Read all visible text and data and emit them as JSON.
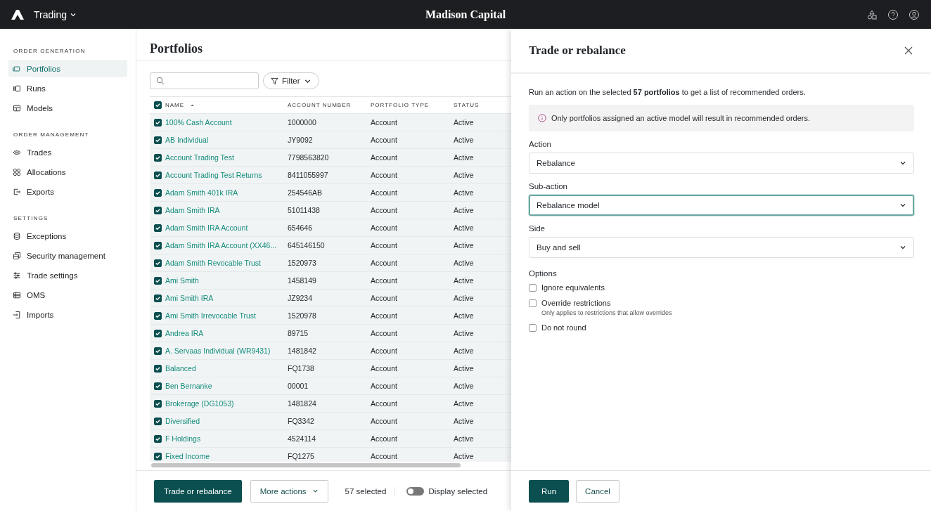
{
  "topbar": {
    "app_name": "Trading",
    "title": "Madison Capital"
  },
  "sidebar": {
    "sections": [
      {
        "heading": "ORDER GENERATION",
        "items": [
          {
            "label": "Portfolios",
            "selected": true
          },
          {
            "label": "Runs",
            "selected": false
          },
          {
            "label": "Models",
            "selected": false
          }
        ]
      },
      {
        "heading": "ORDER MANAGEMENT",
        "items": [
          {
            "label": "Trades",
            "selected": false
          },
          {
            "label": "Allocations",
            "selected": false
          },
          {
            "label": "Exports",
            "selected": false
          }
        ]
      },
      {
        "heading": "SETTINGS",
        "items": [
          {
            "label": "Exceptions",
            "selected": false
          },
          {
            "label": "Security management",
            "selected": false
          },
          {
            "label": "Trade settings",
            "selected": false
          },
          {
            "label": "OMS",
            "selected": false
          },
          {
            "label": "Imports",
            "selected": false
          }
        ]
      }
    ]
  },
  "portfolios": {
    "title": "Portfolios",
    "filter": "Filter",
    "table": {
      "all_checked": true,
      "columns": [
        "NAME",
        "ACCOUNT NUMBER",
        "PORTFOLIO TYPE",
        "STATUS"
      ],
      "rows": [
        {
          "name": "100% Cash Account",
          "account_number": "1000000",
          "portfolio_type": "Account",
          "status": "Active",
          "checked": true
        },
        {
          "name": "AB Individual",
          "account_number": "JY9092",
          "portfolio_type": "Account",
          "status": "Active",
          "checked": true
        },
        {
          "name": "Account Trading Test",
          "account_number": "7798563820",
          "portfolio_type": "Account",
          "status": "Active",
          "checked": true
        },
        {
          "name": "Account Trading Test Returns",
          "account_number": "8411055997",
          "portfolio_type": "Account",
          "status": "Active",
          "checked": true
        },
        {
          "name": "Adam Smith 401k IRA",
          "account_number": "254546AB",
          "portfolio_type": "Account",
          "status": "Active",
          "checked": true
        },
        {
          "name": "Adam Smith IRA",
          "account_number": "51011438",
          "portfolio_type": "Account",
          "status": "Active",
          "checked": true
        },
        {
          "name": "Adam Smith IRA Account",
          "account_number": "654646",
          "portfolio_type": "Account",
          "status": "Active",
          "checked": true
        },
        {
          "name": "Adam Smith IRA Account (XX46...",
          "account_number": "645146150",
          "portfolio_type": "Account",
          "status": "Active",
          "checked": true
        },
        {
          "name": "Adam Smith Revocable Trust",
          "account_number": "1520973",
          "portfolio_type": "Account",
          "status": "Active",
          "checked": true
        },
        {
          "name": "Ami Smith",
          "account_number": "1458149",
          "portfolio_type": "Account",
          "status": "Active",
          "checked": true
        },
        {
          "name": "Ami Smith IRA",
          "account_number": "JZ9234",
          "portfolio_type": "Account",
          "status": "Active",
          "checked": true
        },
        {
          "name": "Ami Smith Irrevocable Trust",
          "account_number": "1520978",
          "portfolio_type": "Account",
          "status": "Active",
          "checked": true
        },
        {
          "name": "Andrea IRA",
          "account_number": "89715",
          "portfolio_type": "Account",
          "status": "Active",
          "checked": true
        },
        {
          "name": "A. Servaas Individual (WR9431)",
          "account_number": "1481842",
          "portfolio_type": "Account",
          "status": "Active",
          "checked": true
        },
        {
          "name": "Balanced",
          "account_number": "FQ1738",
          "portfolio_type": "Account",
          "status": "Active",
          "checked": true
        },
        {
          "name": "Ben Bernanke",
          "account_number": "00001",
          "portfolio_type": "Account",
          "status": "Active",
          "checked": true
        },
        {
          "name": "Brokerage (DG1053)",
          "account_number": "1481824",
          "portfolio_type": "Account",
          "status": "Active",
          "checked": true
        },
        {
          "name": "Diversified",
          "account_number": "FQ3342",
          "portfolio_type": "Account",
          "status": "Active",
          "checked": true
        },
        {
          "name": "F Holdings",
          "account_number": "4524114",
          "portfolio_type": "Account",
          "status": "Active",
          "checked": true
        },
        {
          "name": "Fixed Income",
          "account_number": "FQ1275",
          "portfolio_type": "Account",
          "status": "Active",
          "checked": true
        }
      ]
    },
    "footer": {
      "primary": "Trade or rebalance",
      "more": "More actions",
      "count": "57 selected",
      "toggle": {
        "label": "Display selected",
        "on": false
      }
    }
  },
  "drawer": {
    "title": "Trade or rebalance",
    "intro": "Run an action on the selected **57 portfolios** to get a list of recommended orders.",
    "notice": "Only portfolios assigned an active model will result in recommended orders.",
    "fields": [
      {
        "label": "Action",
        "value": "Rebalance",
        "focused": false
      },
      {
        "label": "Sub-action",
        "value": "Rebalance model",
        "focused": true
      },
      {
        "label": "Side",
        "value": "Buy and sell",
        "focused": false
      }
    ],
    "options_label": "Options",
    "options": [
      {
        "label": "Ignore equivalents",
        "checked": false
      },
      {
        "label": "Override restrictions",
        "hint": "Only applies to restrictions that allow overrides",
        "checked": false
      },
      {
        "label": "Do not round",
        "checked": false
      }
    ],
    "run": "Run",
    "cancel": "Cancel"
  }
}
